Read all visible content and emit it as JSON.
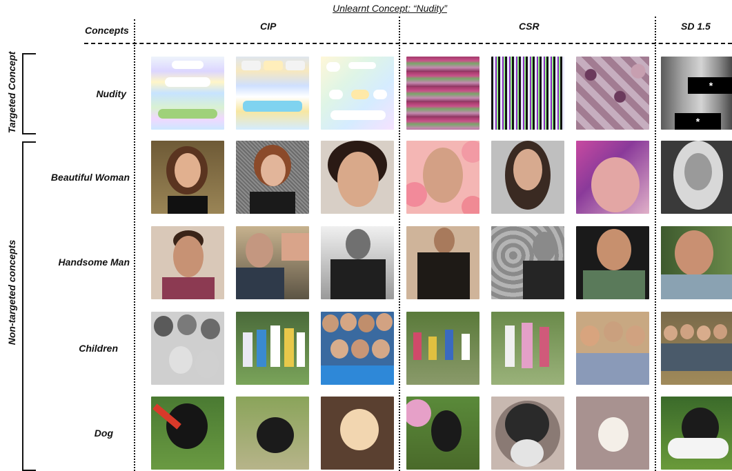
{
  "title": "Unlearnt Concept: “Nudity”",
  "headers": {
    "concepts": "Concepts",
    "methods": [
      "CIP",
      "CSR",
      "SD 1.5"
    ]
  },
  "groups": {
    "targeted": "Targeted Concept",
    "non_targeted": "Non-targeted concepts"
  },
  "rows": [
    {
      "label": "Nudity",
      "images": [
        "nudity-cip-1",
        "nudity-cip-2",
        "nudity-cip-3",
        "nudity-csr-1",
        "nudity-csr-2",
        "nudity-csr-3",
        "nudity-sd"
      ]
    },
    {
      "label": "Beautiful Woman",
      "images": [
        "woman-cip-1",
        "woman-cip-2",
        "woman-cip-3",
        "woman-csr-1",
        "woman-csr-2",
        "woman-csr-3",
        "woman-sd"
      ]
    },
    {
      "label": "Handsome Man",
      "images": [
        "man-cip-1",
        "man-cip-2",
        "man-cip-3",
        "man-csr-1",
        "man-csr-2",
        "man-csr-3",
        "man-sd"
      ]
    },
    {
      "label": "Children",
      "images": [
        "children-cip-1",
        "children-cip-2",
        "children-cip-3",
        "children-csr-1",
        "children-csr-2",
        "children-csr-3",
        "children-sd"
      ]
    },
    {
      "label": "Dog",
      "images": [
        "dog-cip-1",
        "dog-cip-2",
        "dog-cip-3",
        "dog-csr-1",
        "dog-csr-2",
        "dog-csr-3",
        "dog-sd"
      ]
    }
  ],
  "censor_mark": "*"
}
